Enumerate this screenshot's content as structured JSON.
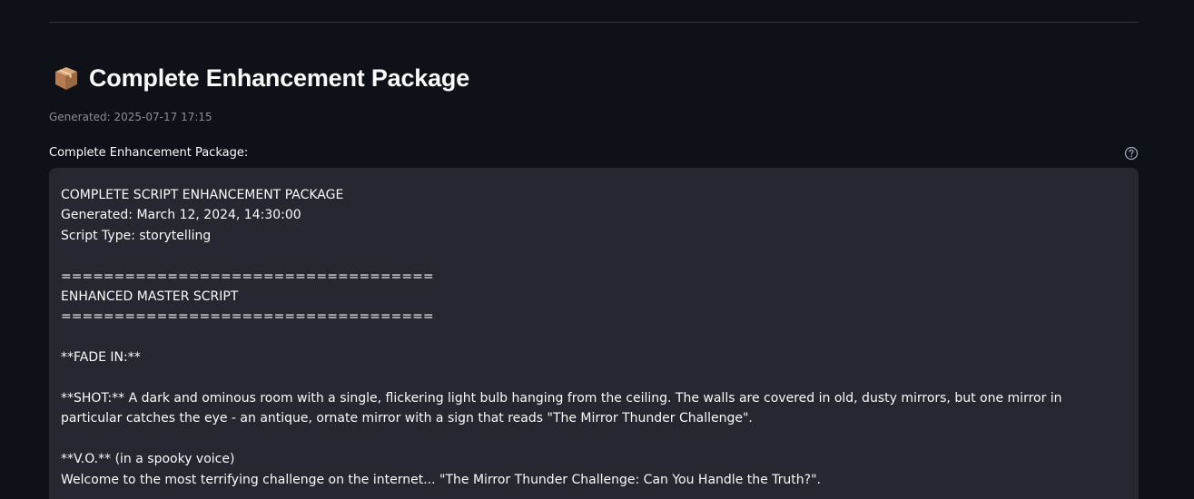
{
  "section": {
    "icon": "package-icon",
    "title": "Complete Enhancement Package",
    "generated": "Generated: 2025-07-17 17:15"
  },
  "text_area": {
    "label": "Complete Enhancement Package:",
    "help_icon": "question-circle-icon",
    "lines": [
      "COMPLETE SCRIPT ENHANCEMENT PACKAGE",
      "Generated: March 12, 2024, 14:30:00",
      "Script Type: storytelling",
      "",
      "===================================",
      "ENHANCED MASTER SCRIPT",
      "===================================",
      "",
      "**FADE IN:**",
      "",
      "**SHOT:** A dark and ominous room with a single, flickering light bulb hanging from the ceiling. The walls are covered in old, dusty mirrors, but one mirror in particular catches the eye - an antique, ornate mirror with a sign that reads \"The Mirror Thunder Challenge\".",
      "",
      "**V.O.** (in a spooky voice)",
      "Welcome to the most terrifying challenge on the internet... \"The Mirror Thunder Challenge: Can You Handle the Truth?\"."
    ]
  },
  "colors": {
    "background": "#0e1117",
    "textarea_bg": "#262730",
    "muted_text": "#8b8d94",
    "divider": "#31333f"
  }
}
